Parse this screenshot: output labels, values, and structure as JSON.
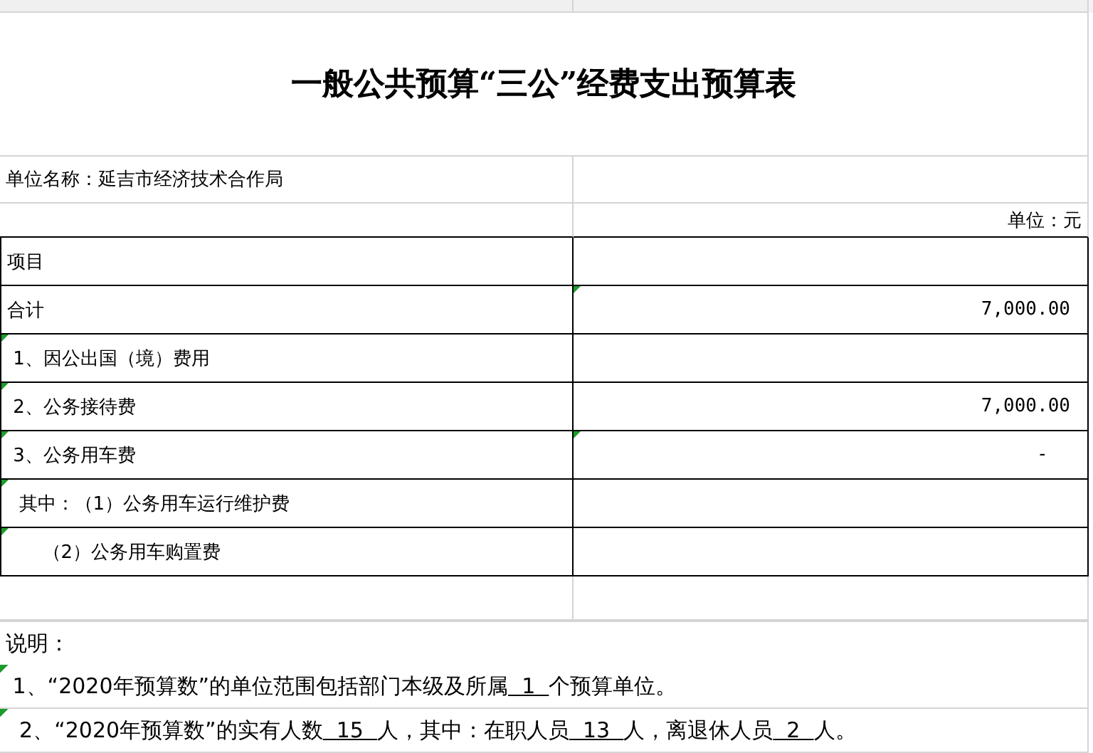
{
  "title": "一般公共预算“三公”经费支出预算表",
  "unit_name": "单位名称：延吉市经济技术合作局",
  "unit": "单位：元",
  "table": {
    "rows": [
      {
        "item": "项目",
        "item_flag": false,
        "amount_flag": false
      },
      {
        "item": "合计",
        "amount": "7,000.00",
        "item_flag": false,
        "amount_flag": true
      },
      {
        "item": " 1、因公出国（境）费用",
        "item_flag": true,
        "amount_flag": false
      },
      {
        "item": " 2、公务接待费",
        "amount": "7,000.00",
        "item_flag": true,
        "amount_flag": false
      },
      {
        "item": " 3、公务用车费",
        "amount": "-  ",
        "item_flag": true,
        "amount_flag": true
      },
      {
        "item": "  其中：（1）公务用车运行维护费",
        "item_flag": true,
        "amount_flag": false
      },
      {
        "item": "      （2）公务用车购置费",
        "item_flag": true,
        "amount_flag": false
      }
    ]
  },
  "notes_heading": "说明：",
  "notes": [
    {
      "flag": true,
      "parts": [
        {
          "text": " 1、“2020年预算数”的单位范围包括部门本级及所属",
          "underlined": false
        },
        {
          "text": "  1  ",
          "underlined": true
        },
        {
          "text": "个预算单位。",
          "underlined": false
        }
      ]
    },
    {
      "flag": true,
      "parts": [
        {
          "text": "  2、“2020年预算数”的实有人数",
          "underlined": false
        },
        {
          "text": "  15  ",
          "underlined": true
        },
        {
          "text": "人，其中：在职人员",
          "underlined": false
        },
        {
          "text": "  13  ",
          "underlined": true
        },
        {
          "text": "人，离退休人员",
          "underlined": false
        },
        {
          "text": "  2  ",
          "underlined": true
        },
        {
          "text": "人。",
          "underlined": false
        }
      ]
    }
  ]
}
